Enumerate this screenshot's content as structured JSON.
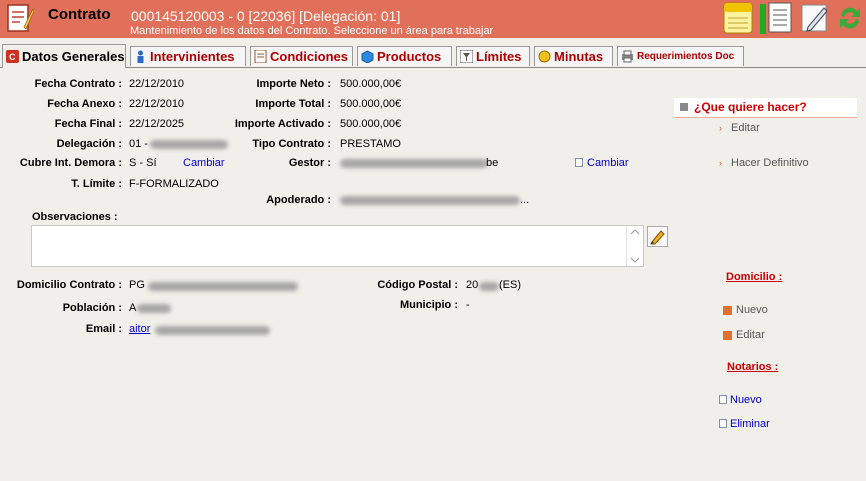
{
  "header": {
    "title": "Contrato",
    "code": "000145120003 - 0 [22036] [Delegación: 01]",
    "subtitle": "Mantenimiento de los datos del Contrato. Seleccione un área para trabajar"
  },
  "tabs": [
    {
      "label": "Datos Generales",
      "icon": "contract-icon"
    },
    {
      "label": "Intervinientes",
      "icon": "person-icon"
    },
    {
      "label": "Condiciones",
      "icon": "document-icon"
    },
    {
      "label": "Productos",
      "icon": "box-icon"
    },
    {
      "label": "Límites",
      "icon": "filter-icon"
    },
    {
      "label": "Minutas",
      "icon": "coin-icon"
    },
    {
      "label": "Requerimientos Doc",
      "icon": "printer-icon"
    }
  ],
  "fields": {
    "fecha_contrato": {
      "label": "Fecha Contrato :",
      "value": "22/12/2010"
    },
    "fecha_anexo": {
      "label": "Fecha Anexo :",
      "value": "22/12/2010"
    },
    "fecha_final": {
      "label": "Fecha Final :",
      "value": "22/12/2025"
    },
    "delegacion": {
      "label": "Delegación :",
      "value": "01 -"
    },
    "cubre": {
      "label": "Cubre Int. Demora :",
      "value": "S - Sí",
      "link": "Cambiar"
    },
    "t_limite": {
      "label": "T. Límite :",
      "value": "F-FORMALIZADO"
    },
    "importe_neto": {
      "label": "Importe Neto :",
      "value": "500.000,00€"
    },
    "importe_total": {
      "label": "Importe Total :",
      "value": "500.000,00€"
    },
    "importe_activado": {
      "label": "Importe Activado :",
      "value": "500.000,00€"
    },
    "tipo_contrato": {
      "label": "Tipo Contrato :",
      "value": "PRESTAMO"
    },
    "gestor": {
      "label": "Gestor :",
      "value": "be",
      "link": "Cambiar"
    },
    "apoderado": {
      "label": "Apoderado :",
      "value": "..."
    },
    "observaciones": {
      "label": "Observaciones :",
      "value": ""
    },
    "domicilio": {
      "label": "Domicilio Contrato :",
      "value": "PG"
    },
    "poblacion": {
      "label": "Población :",
      "value": "A"
    },
    "email": {
      "label": "Email :",
      "value": "aitor"
    },
    "codigo_postal": {
      "label": "Código Postal :",
      "value": "20",
      "suffix": "(ES)"
    },
    "municipio": {
      "label": "Municipio :",
      "value": "-"
    }
  },
  "actions": {
    "title": "¿Que quiere hacer?",
    "items": [
      "Editar",
      "Hacer Definitivo"
    ]
  },
  "domicilio_panel": {
    "title": "Domicilio :",
    "items": [
      "Nuevo",
      "Editar"
    ]
  },
  "notarios_panel": {
    "title": "Notarios :",
    "items": [
      "Nuevo",
      "Eliminar"
    ]
  },
  "colors": {
    "header_bg": "#e0705a",
    "accent_red": "#cc0000",
    "link_blue": "#0000cc",
    "page_bg": "#f0efea"
  }
}
